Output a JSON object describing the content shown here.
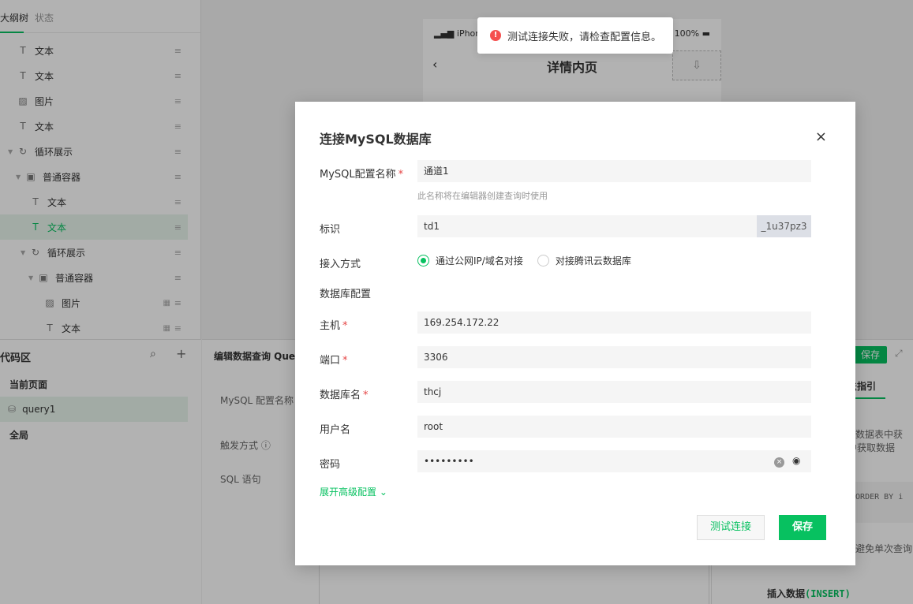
{
  "left_panel": {
    "tabs": [
      "大纲树",
      "状态"
    ],
    "tree": [
      {
        "label": "文本",
        "icon": "text-icon",
        "indent": 1
      },
      {
        "label": "文本",
        "icon": "text-icon",
        "indent": 1
      },
      {
        "label": "图片",
        "icon": "image-icon",
        "indent": 1
      },
      {
        "label": "文本",
        "icon": "text-icon",
        "indent": 1
      },
      {
        "label": "循环展示",
        "icon": "loop-icon",
        "indent": 0
      },
      {
        "label": "普通容器",
        "icon": "container-icon",
        "indent": 1
      },
      {
        "label": "文本",
        "icon": "text-icon",
        "indent": 2
      },
      {
        "label": "文本",
        "icon": "text-icon",
        "indent": 2
      },
      {
        "label": "循环展示",
        "icon": "loop-icon",
        "indent": 1
      },
      {
        "label": "普通容器",
        "icon": "container-icon",
        "indent": 2
      },
      {
        "label": "图片",
        "icon": "image-icon",
        "indent": 3
      },
      {
        "label": "文本",
        "icon": "text-icon",
        "indent": 3
      }
    ],
    "code_area_title": "代码区",
    "current_page": "当前页面",
    "query": "query1",
    "global": "全局"
  },
  "editor": {
    "title": "编辑数据查询 Query",
    "config_label": "MySQL 配置名称",
    "trigger_label": "触发方式",
    "sql_label": "SQL 语句",
    "save": "保存",
    "guide_tab": "语法指引",
    "guide_line1": "从数据表中获",
    "guide_line2": "表中获取数据",
    "guide_code": "s ORDER BY i",
    "guide_line3": "于避免单次查询",
    "insert_label": "插入数据",
    "insert_kw": "(INSERT)"
  },
  "phone": {
    "carrier": "iPhone",
    "battery": "100%",
    "back": "‹",
    "title": "详情内页"
  },
  "toast": {
    "message": "测试连接失败，请检查配置信息。"
  },
  "modal": {
    "title": "连接MySQL数据库",
    "config_name_label": "MySQL配置名称",
    "config_name_value": "通道1",
    "config_name_hint": "此名称将在编辑器创建查询时使用",
    "id_label": "标识",
    "id_value": "td1",
    "id_suffix": "_1u37pz3",
    "access_label": "接入方式",
    "access_options": [
      "通过公网IP/域名对接",
      "对接腾讯云数据库"
    ],
    "db_config_label": "数据库配置",
    "host_label": "主机",
    "host_value": "169.254.172.22",
    "port_label": "端口",
    "port_value": "3306",
    "dbname_label": "数据库名",
    "dbname_value": "thcj",
    "user_label": "用户名",
    "user_value": "root",
    "password_label": "密码",
    "password_value": "•••••••••",
    "advanced": "展开高级配置",
    "test_button": "测试连接",
    "save_button": "保存"
  },
  "colors": {
    "accent": "#07c160",
    "error": "#f5504f"
  }
}
